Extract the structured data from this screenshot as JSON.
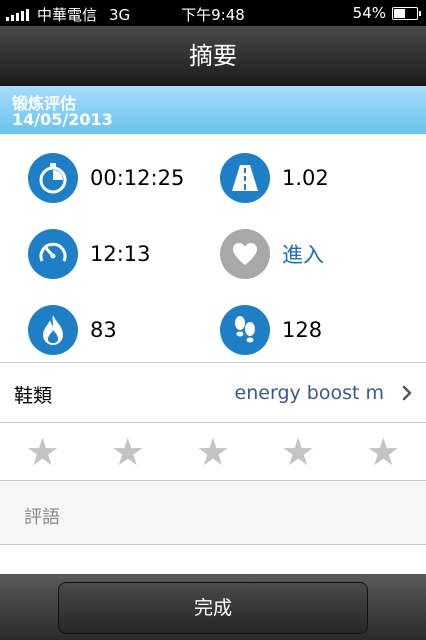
{
  "status_bar": {
    "carrier": "中華電信",
    "network": "3G",
    "time": "下午9:48",
    "battery": "54%",
    "battery_level": 0.54
  },
  "nav": {
    "title": "摘要"
  },
  "header": {
    "title": "锻炼评估",
    "date": "14/05/2013"
  },
  "stats": [
    {
      "icon": "stopwatch-icon",
      "value": "00:12:25"
    },
    {
      "icon": "road-icon",
      "value": "1.02"
    },
    {
      "icon": "speedometer-icon",
      "value": "12:13"
    },
    {
      "icon": "heart-icon",
      "value": "進入"
    },
    {
      "icon": "flame-icon",
      "value": "83"
    },
    {
      "icon": "footsteps-icon",
      "value": "128"
    }
  ],
  "shoes": {
    "label": "鞋類",
    "value": "energy boost m"
  },
  "rating": {
    "max": 5,
    "value": 0
  },
  "comment": {
    "placeholder": "評語"
  },
  "toolbar": {
    "done_label": "完成"
  },
  "colors": {
    "accent": "#1f7fc6",
    "header_blue": "#6cc3f1",
    "star_empty": "#c4c4c4"
  }
}
